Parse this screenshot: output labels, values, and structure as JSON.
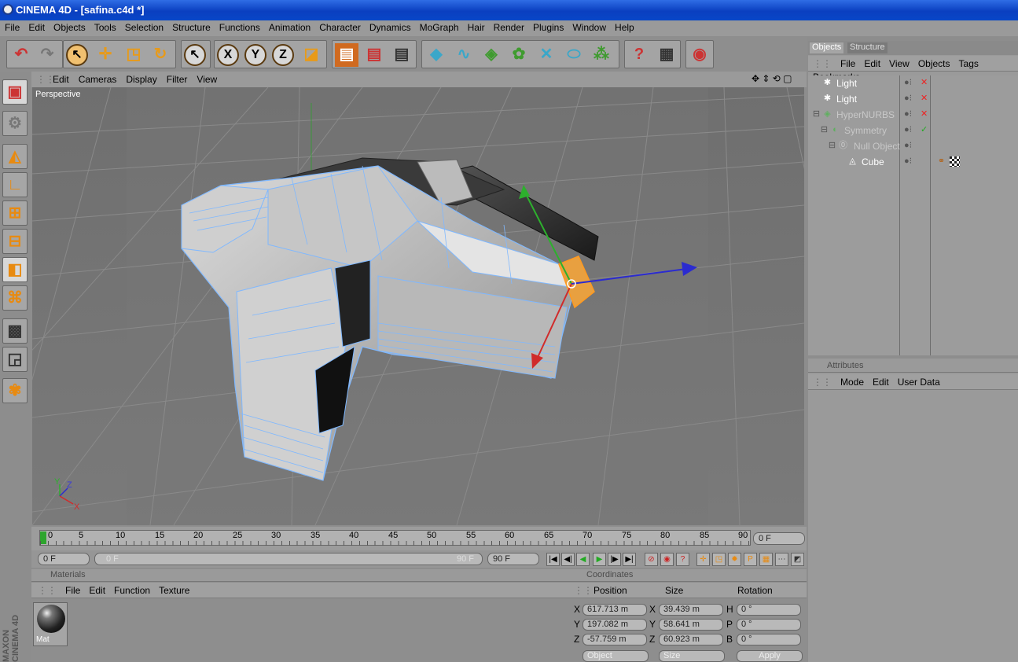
{
  "window": {
    "title": "CINEMA 4D - [safina.c4d *]"
  },
  "menubar": [
    "File",
    "Edit",
    "Objects",
    "Tools",
    "Selection",
    "Structure",
    "Functions",
    "Animation",
    "Character",
    "Dynamics",
    "MoGraph",
    "Hair",
    "Render",
    "Plugins",
    "Window",
    "Help"
  ],
  "toolbar_icons": [
    "undo-icon",
    "redo-icon",
    "select-icon",
    "move-icon",
    "scale-icon",
    "rotate-icon",
    "live-select-icon",
    "x-axis-lock",
    "y-axis-lock",
    "z-axis-lock",
    "world-coordinates-icon",
    "render-view-icon",
    "render-picture-viewer-icon",
    "render-settings-icon",
    "cube-primitive-icon",
    "spline-icon",
    "nurbs-icon",
    "array-icon",
    "deformer-icon",
    "scene-icon",
    "particle-icon",
    "help-icon",
    "coordinate-manager-icon",
    "browser-icon"
  ],
  "toolbar_axes": {
    "x": "X",
    "y": "Y",
    "z": "Z"
  },
  "viewport": {
    "menu": [
      "Edit",
      "Cameras",
      "Display",
      "Filter",
      "View"
    ],
    "label": "Perspective",
    "axis_labels": {
      "y": "Y",
      "z": "Z",
      "x": "X"
    }
  },
  "timeline": {
    "ticks": [
      "0",
      "5",
      "10",
      "15",
      "20",
      "25",
      "30",
      "35",
      "40",
      "45",
      "50",
      "55",
      "60",
      "65",
      "70",
      "75",
      "80",
      "85",
      "90"
    ],
    "current_frame": "0 F",
    "start_frame": "0 F",
    "range_start": "0 F",
    "range_end": "90 F",
    "end_frame": "90 F"
  },
  "materials": {
    "title": "Materials",
    "menu": [
      "File",
      "Edit",
      "Function",
      "Texture"
    ],
    "items": [
      {
        "name": "Mat"
      }
    ]
  },
  "coordinates": {
    "title": "Coordinates",
    "headers": {
      "position": "Position",
      "size": "Size",
      "rotation": "Rotation"
    },
    "rows": [
      {
        "axis": "X",
        "position": "617.713 m",
        "size_axis": "X",
        "size": "39.439 m",
        "rot_axis": "H",
        "rotation": "0 °"
      },
      {
        "axis": "Y",
        "position": "197.082 m",
        "size_axis": "Y",
        "size": "58.641 m",
        "rot_axis": "P",
        "rotation": "0 °"
      },
      {
        "axis": "Z",
        "position": "-57.759 m",
        "size_axis": "Z",
        "size": "60.923 m",
        "rot_axis": "B",
        "rotation": "0 °"
      }
    ],
    "mode_object": "Object",
    "mode_size": "Size",
    "apply_label": "Apply"
  },
  "objects_panel": {
    "tabs": [
      "Objects",
      "Structure"
    ],
    "menu": [
      "File",
      "Edit",
      "View",
      "Objects",
      "Tags",
      "Bookmarks"
    ],
    "items": [
      {
        "name": "Light",
        "depth": 0
      },
      {
        "name": "Light",
        "depth": 0
      },
      {
        "name": "HyperNURBS",
        "depth": 0
      },
      {
        "name": "Symmetry",
        "depth": 1
      },
      {
        "name": "Null Object",
        "depth": 2
      },
      {
        "name": "Cube",
        "depth": 3
      }
    ]
  },
  "attributes_panel": {
    "title": "Attributes",
    "menu": [
      "Mode",
      "Edit",
      "User Data"
    ]
  },
  "brand": {
    "line1": "MAXON",
    "line2": "CINEMA 4D"
  },
  "colors": {
    "accent_orange": "#e88a10",
    "title_blue": "#0a3fc0",
    "wire_blue": "#7fb8ff"
  }
}
